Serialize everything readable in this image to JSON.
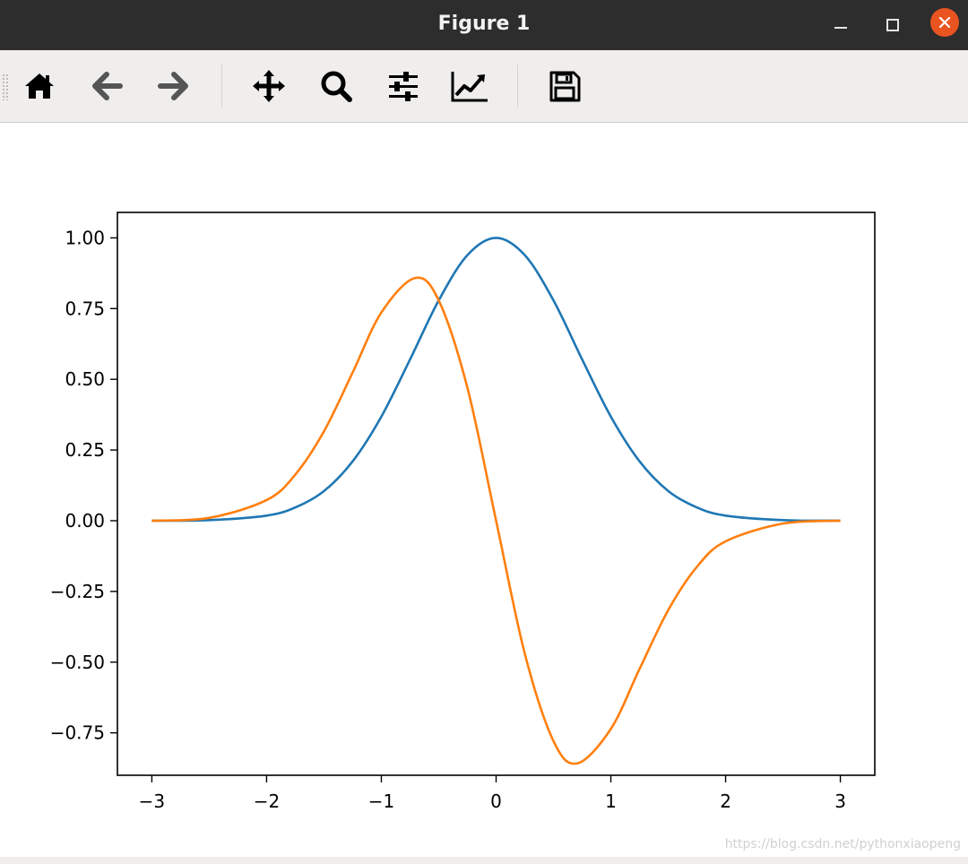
{
  "window": {
    "title": "Figure 1",
    "controls": {
      "minimize_icon": "minimize-icon",
      "maximize_icon": "maximize-icon",
      "close_icon": "close-icon",
      "close_color": "#e95420"
    }
  },
  "toolbar": {
    "buttons": [
      {
        "name": "home",
        "icon": "home-icon"
      },
      {
        "name": "back",
        "icon": "arrow-left-icon"
      },
      {
        "name": "forward",
        "icon": "arrow-right-icon"
      },
      {
        "name": "pan",
        "icon": "move-icon"
      },
      {
        "name": "zoom",
        "icon": "magnifier-icon"
      },
      {
        "name": "configure-subplots",
        "icon": "sliders-icon"
      },
      {
        "name": "edit-axes",
        "icon": "line-chart-icon"
      },
      {
        "name": "save",
        "icon": "floppy-disk-icon"
      }
    ]
  },
  "watermark": "https://blog.csdn.net/pythonxiaopeng",
  "chart_data": {
    "type": "line",
    "title": "",
    "xlabel": "",
    "ylabel": "",
    "xlim": [
      -3.3,
      3.3
    ],
    "ylim": [
      -0.9,
      1.09
    ],
    "xticks": [
      -3,
      -2,
      -1,
      0,
      1,
      2,
      3
    ],
    "xtick_labels": [
      "−3",
      "−2",
      "−1",
      "0",
      "1",
      "2",
      "3"
    ],
    "yticks": [
      1.0,
      0.75,
      0.5,
      0.25,
      0.0,
      -0.25,
      -0.5,
      -0.75
    ],
    "ytick_labels": [
      "1.00",
      "0.75",
      "0.50",
      "0.25",
      "0.00",
      "−0.25",
      "−0.50",
      "−0.75"
    ],
    "grid": false,
    "series": [
      {
        "color": "#1f77b4",
        "x": [
          -3.0,
          -2.5,
          -2.0,
          -1.75,
          -1.5,
          -1.25,
          -1.0,
          -0.75,
          -0.5,
          -0.25,
          0.0,
          0.25,
          0.5,
          0.75,
          1.0,
          1.25,
          1.5,
          1.75,
          2.0,
          2.5,
          3.0
        ],
        "y": [
          0.0,
          0.002,
          0.018,
          0.047,
          0.105,
          0.21,
          0.368,
          0.57,
          0.779,
          0.939,
          1.0,
          0.939,
          0.779,
          0.57,
          0.368,
          0.21,
          0.105,
          0.047,
          0.018,
          0.002,
          0.0
        ]
      },
      {
        "color": "#ff7f0e",
        "x": [
          -3.0,
          -2.5,
          -2.0,
          -1.75,
          -1.5,
          -1.25,
          -1.0,
          -0.707,
          -0.5,
          -0.25,
          0.0,
          0.25,
          0.5,
          0.707,
          1.0,
          1.25,
          1.5,
          1.75,
          2.0,
          2.5,
          3.0
        ],
        "y": [
          0.0,
          0.01,
          0.073,
          0.163,
          0.316,
          0.524,
          0.736,
          0.858,
          0.779,
          0.47,
          0.0,
          -0.47,
          -0.779,
          -0.858,
          -0.736,
          -0.524,
          -0.316,
          -0.163,
          -0.073,
          -0.01,
          0.0
        ]
      }
    ]
  }
}
